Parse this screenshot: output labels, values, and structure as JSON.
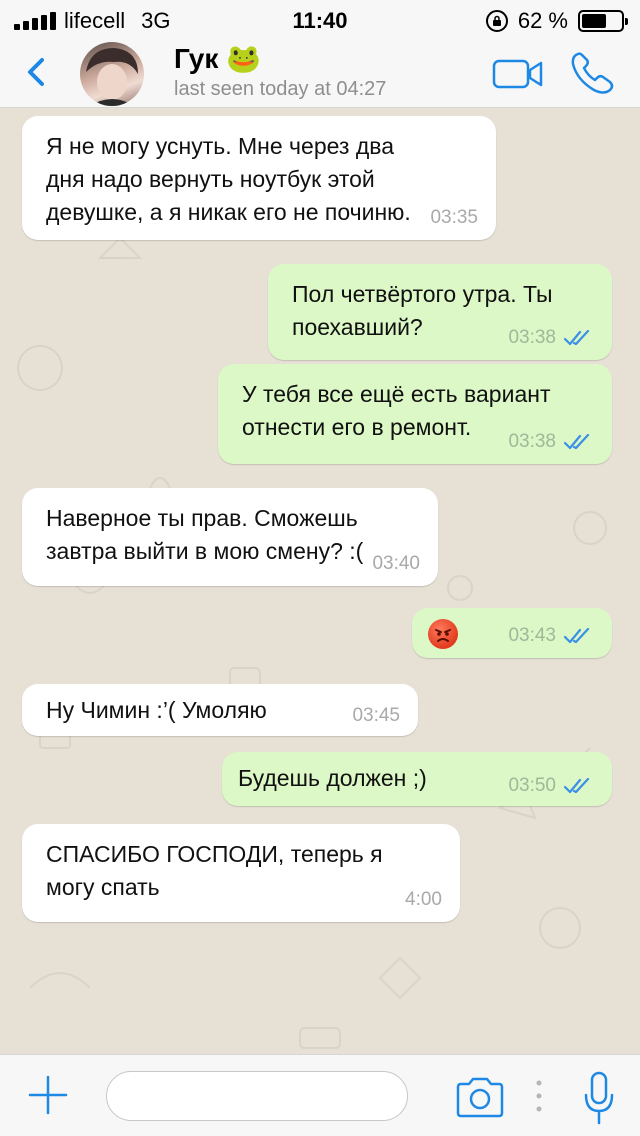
{
  "status_bar": {
    "carrier": "lifecell",
    "network": "3G",
    "time": "11:40",
    "battery_text": "62 %",
    "battery_level": 0.62
  },
  "header": {
    "contact_name": "Гук 🐸",
    "last_seen": "last seen today at 04:27",
    "icons": [
      "back-chevron-icon",
      "video-call-icon",
      "phone-icon"
    ]
  },
  "messages": [
    {
      "direction": "in",
      "text": "Я не могу уснуть. Мне через два\nдня надо вернуть ноутбук этой\nдевушке, а я никак его не починю.",
      "time": "03:35"
    },
    {
      "direction": "out",
      "text": "Пол четвёртого утра. Ты\nпоехавший?",
      "time": "03:38",
      "read": true
    },
    {
      "direction": "out",
      "text": "У тебя все ещё есть вариант\nотнести его в ремонт.",
      "time": "03:38",
      "read": true
    },
    {
      "direction": "in",
      "text": "Наверное ты прав. Сможешь\nзавтра выйти в мою смену? :(",
      "time": "03:40"
    },
    {
      "direction": "out",
      "text": "",
      "emoji": "angry-face-emoji",
      "time": "03:43",
      "read": true
    },
    {
      "direction": "in",
      "text": "Ну Чимин :’( Умоляю",
      "time": "03:45"
    },
    {
      "direction": "out",
      "text": "Будешь должен ;)",
      "time": "03:50",
      "read": true
    },
    {
      "direction": "in",
      "text": "СПАСИБО ГОСПОДИ, теперь я\nмогу спать",
      "time": "4:00"
    }
  ],
  "input_bar": {
    "message_value": "",
    "icons": [
      "plus-icon",
      "camera-icon",
      "microphone-icon"
    ]
  },
  "colors": {
    "accent": "#1e88e5",
    "incoming_bubble": "#ffffff",
    "outgoing_bubble": "#dcf8c6",
    "read_ticks": "#3a8fe8",
    "chat_background": "#e6e0d5"
  }
}
